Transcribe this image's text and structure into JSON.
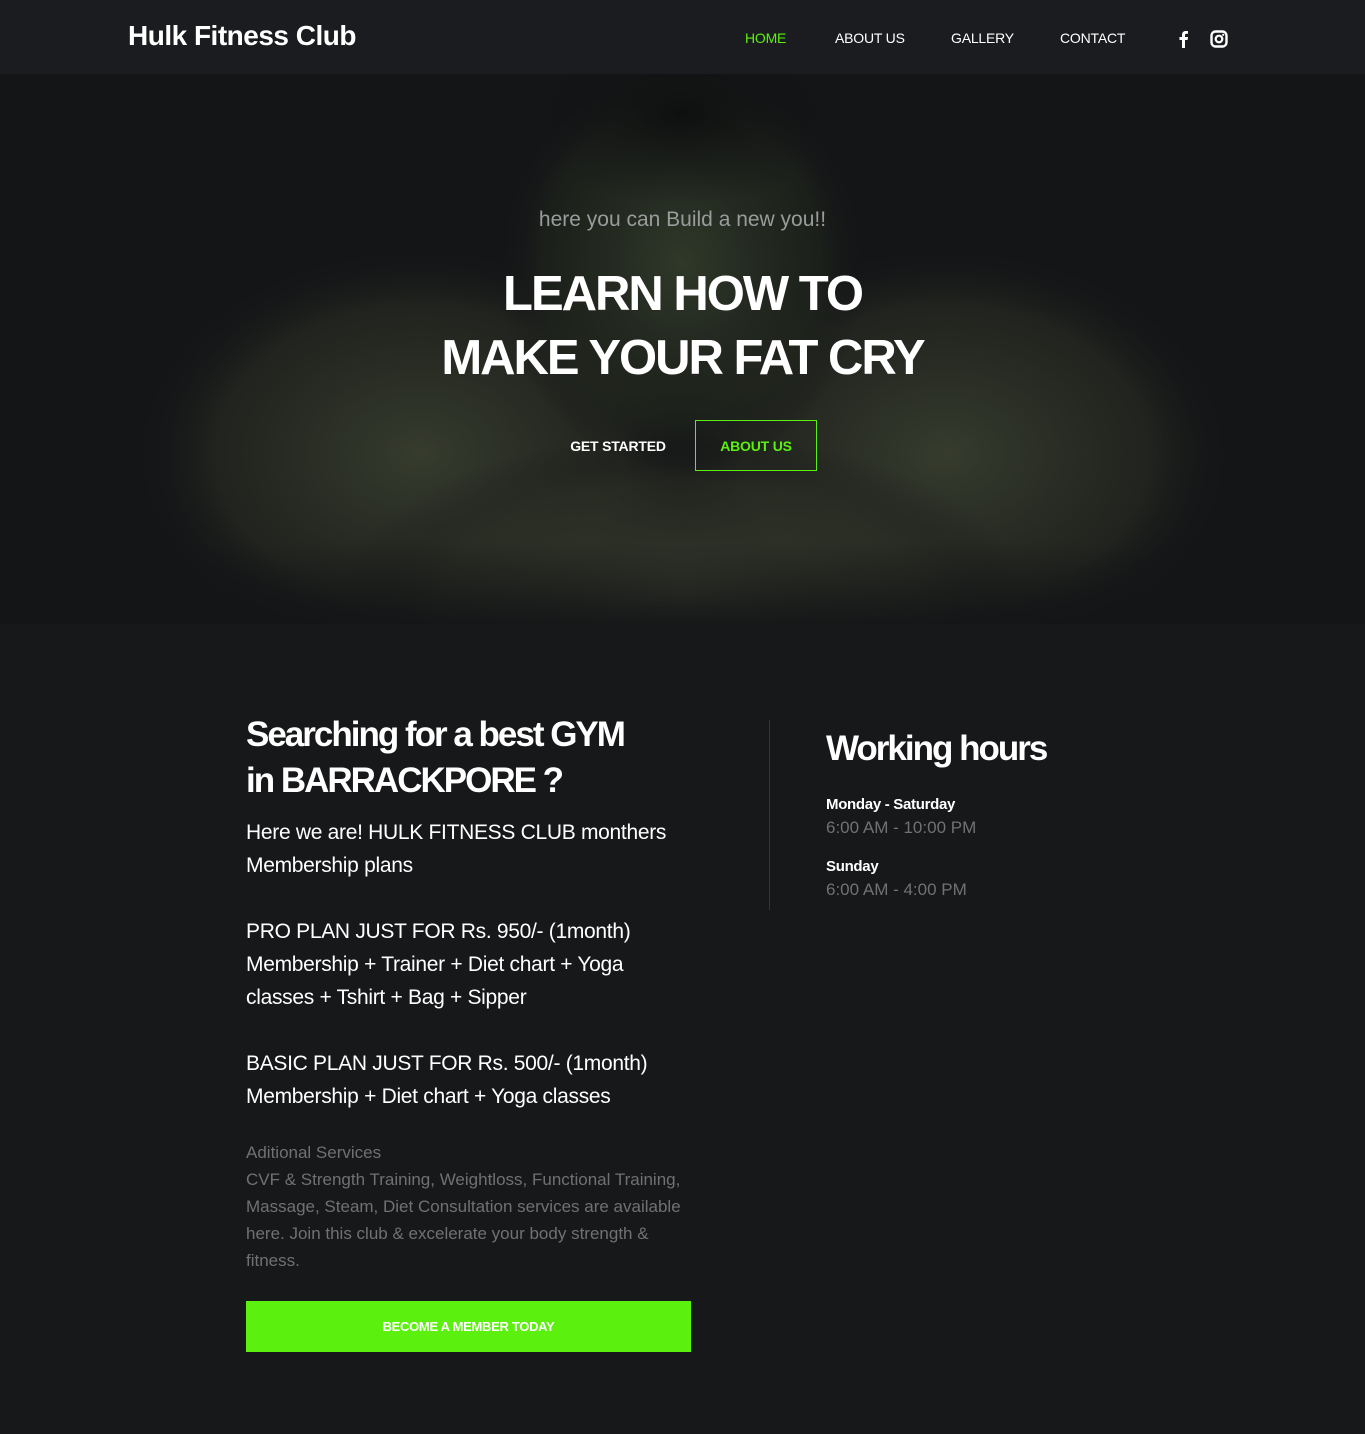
{
  "navbar": {
    "brand": "Hulk Fitness Club",
    "links": [
      "HOME",
      "ABOUT US",
      "GALLERY",
      "CONTACT"
    ],
    "active_link": "HOME",
    "social_icons": [
      "facebook-icon",
      "instagram-icon"
    ]
  },
  "hero": {
    "tagline": "here you can Build a new you!!",
    "title_line1": "LEARN HOW TO",
    "title_line2": "MAKE YOUR FAT CRY",
    "primary_button": "GET STARTED",
    "secondary_button": "ABOUT US"
  },
  "about": {
    "title_line1": "Searching for a best GYM",
    "title_line2": "in BARRACKPORE ?",
    "intro": "Here we are! HULK FITNESS CLUB monthers Membership plans",
    "pro_plan_line1": "PRO PLAN JUST FOR Rs. 950/- (1month)",
    "pro_plan_line2": "Membership + Trainer + Diet chart + Yoga classes + Tshirt + Bag + Sipper",
    "basic_plan_line1": "BASIC PLAN JUST FOR Rs. 500/- (1month)",
    "basic_plan_line2": "Membership + Diet chart + Yoga classes",
    "services_heading": "Aditional Services",
    "services_text": "CVF & Strength Training, Weightloss, Functional Training, Massage, Steam, Diet Consultation services are available here. Join this club & excelerate your body strength & fitness.",
    "cta_button": "BECOME A MEMBER TODAY"
  },
  "hours": {
    "title": "Working hours",
    "entries": [
      {
        "day": "Monday - Saturday",
        "time": "6:00 AM - 10:00 PM"
      },
      {
        "day": "Sunday",
        "time": "6:00 AM - 4:00 PM"
      }
    ]
  },
  "colors": {
    "accent": "#5cf00e",
    "background": "#17181a",
    "navbar": "#1b1c1f",
    "muted_text": "#6f7173"
  }
}
